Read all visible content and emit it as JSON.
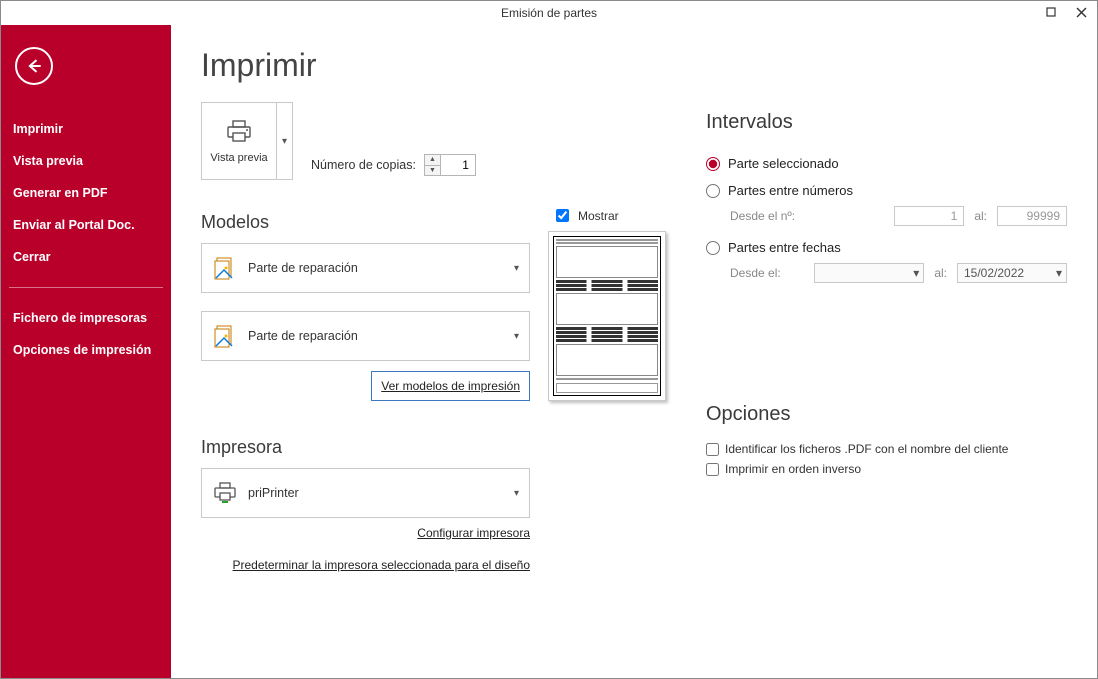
{
  "titlebar": {
    "title": "Emisión de partes"
  },
  "sidebar": {
    "items": [
      {
        "label": "Imprimir"
      },
      {
        "label": "Vista previa"
      },
      {
        "label": "Generar en PDF"
      },
      {
        "label": "Enviar al Portal Doc."
      },
      {
        "label": "Cerrar"
      }
    ],
    "items2": [
      {
        "label": "Fichero de impresoras"
      },
      {
        "label": "Opciones de impresión"
      }
    ]
  },
  "page": {
    "heading": "Imprimir",
    "preview_button": "Vista previa",
    "copies_label": "Número de copias:",
    "copies_value": "1"
  },
  "modelos": {
    "heading": "Modelos",
    "mostrar_label": "Mostrar",
    "items": [
      {
        "label": "Parte de reparación"
      },
      {
        "label": "Parte de reparación"
      }
    ],
    "link": "Ver modelos de impresión"
  },
  "impresora": {
    "heading": "Impresora",
    "selected": "priPrinter",
    "link_config": "Configurar impresora",
    "link_default": "Predeterminar la impresora seleccionada para el diseño"
  },
  "intervalos": {
    "heading": "Intervalos",
    "radio1": "Parte seleccionado",
    "radio2": "Partes entre números",
    "radio3": "Partes entre fechas",
    "desde_num_label": "Desde el nº:",
    "desde_num_value": "1",
    "al_label": "al:",
    "hasta_num_value": "99999",
    "desde_fecha_label": "Desde el:",
    "hasta_fecha_value": "15/02/2022"
  },
  "opciones": {
    "heading": "Opciones",
    "chk1": "Identificar los ficheros .PDF con el nombre del cliente",
    "chk2": "Imprimir en orden inverso"
  }
}
